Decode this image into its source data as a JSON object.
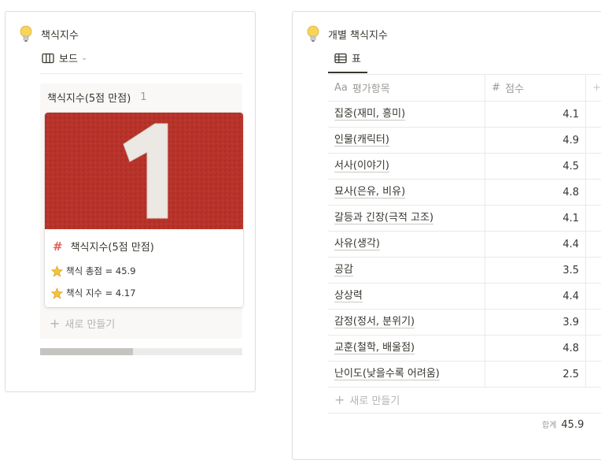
{
  "left": {
    "title": "책식지수",
    "view_label": "보드",
    "column": {
      "title": "책식지수(5점 만점)",
      "count": "1"
    },
    "card": {
      "cover_number": "1",
      "title": "책식지수(5점 만점)",
      "prop1": "책식 총점 = 45.9",
      "prop2": "책식 지수 = 4.17"
    },
    "new_label": "새로 만들기",
    "scroll_fraction": 0.46
  },
  "right": {
    "title": "개별 책식지수",
    "view_label": "표",
    "col_name": "평가항목",
    "col_name_icon": "Aa",
    "col_score": "점수",
    "col_score_icon": "#",
    "rows": [
      {
        "name": "집중(재미, 흥미)",
        "score": "4.1"
      },
      {
        "name": "인물(캐릭터)",
        "score": "4.9"
      },
      {
        "name": "서사(이야기)",
        "score": "4.5"
      },
      {
        "name": "묘사(은유, 비유)",
        "score": "4.8"
      },
      {
        "name": "갈등과 긴장(극적 고조)",
        "score": "4.1"
      },
      {
        "name": "사유(생각)",
        "score": "4.4"
      },
      {
        "name": "공감",
        "score": "3.5"
      },
      {
        "name": "상상력",
        "score": "4.4"
      },
      {
        "name": "감정(정서, 분위기)",
        "score": "3.9"
      },
      {
        "name": "교훈(철학, 배울점)",
        "score": "4.8"
      },
      {
        "name": "난이도(낮을수록 어려움)",
        "score": "2.5"
      }
    ],
    "new_label": "새로 만들기",
    "sum_label": "합계",
    "sum_value": "45.9"
  }
}
